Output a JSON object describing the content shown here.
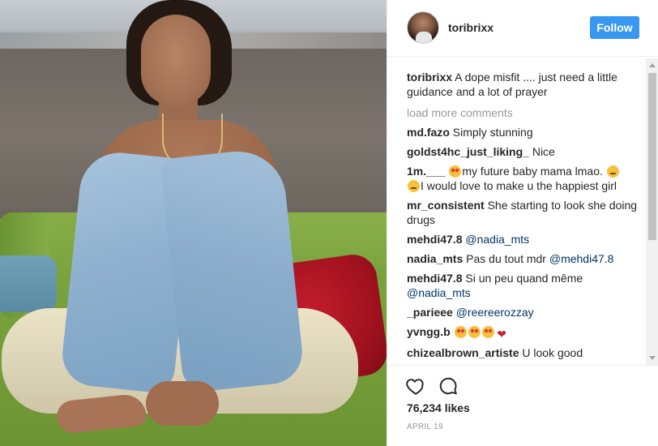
{
  "post": {
    "username": "toribrixx",
    "follow_label": "Follow",
    "caption": {
      "username": "toribrixx",
      "text": "A dope misfit .... just need a little guidance and a lot of prayer"
    },
    "load_more_label": "load more comments",
    "comments": [
      {
        "username": "md.fazo",
        "text": "Simply stunning"
      },
      {
        "username": "goldst4hc_just_liking_",
        "text": "Nice"
      },
      {
        "username": "1m.___",
        "text_before": "",
        "emoji1": "heart-eyes-emoji",
        "text_mid": "my future baby mama lmao.",
        "emoji2": "smirk-emoji",
        "emoji3": "smirk-emoji",
        "text_after": "I would love to make u the happiest girl"
      },
      {
        "username": "mr_consistent",
        "text": "She starting to look she doing drugs"
      },
      {
        "username": "mehdi47.8",
        "mention": "@nadia_mts"
      },
      {
        "username": "nadia_mts",
        "text": "Pas du tout mdr",
        "mention": "@mehdi47.8"
      },
      {
        "username": "mehdi47.8",
        "text": "Si un peu quand même",
        "mention": "@nadia_mts"
      },
      {
        "username": "_parieee",
        "mention": "@reereerozzay"
      },
      {
        "username": "yvngg.b",
        "emojis": [
          "heart-eyes-emoji",
          "heart-eyes-emoji",
          "heart-eyes-emoji",
          "red-heart-emoji"
        ]
      },
      {
        "username": "chizealbrown_artiste",
        "text": "U look good"
      }
    ],
    "likes": "76,234 likes",
    "date": "APRIL 19",
    "icons": {
      "like": "heart-outline-icon",
      "comment": "speech-bubble-icon"
    },
    "colors": {
      "follow_button": "#3897f0",
      "mention": "#003569",
      "muted": "#999999"
    }
  }
}
